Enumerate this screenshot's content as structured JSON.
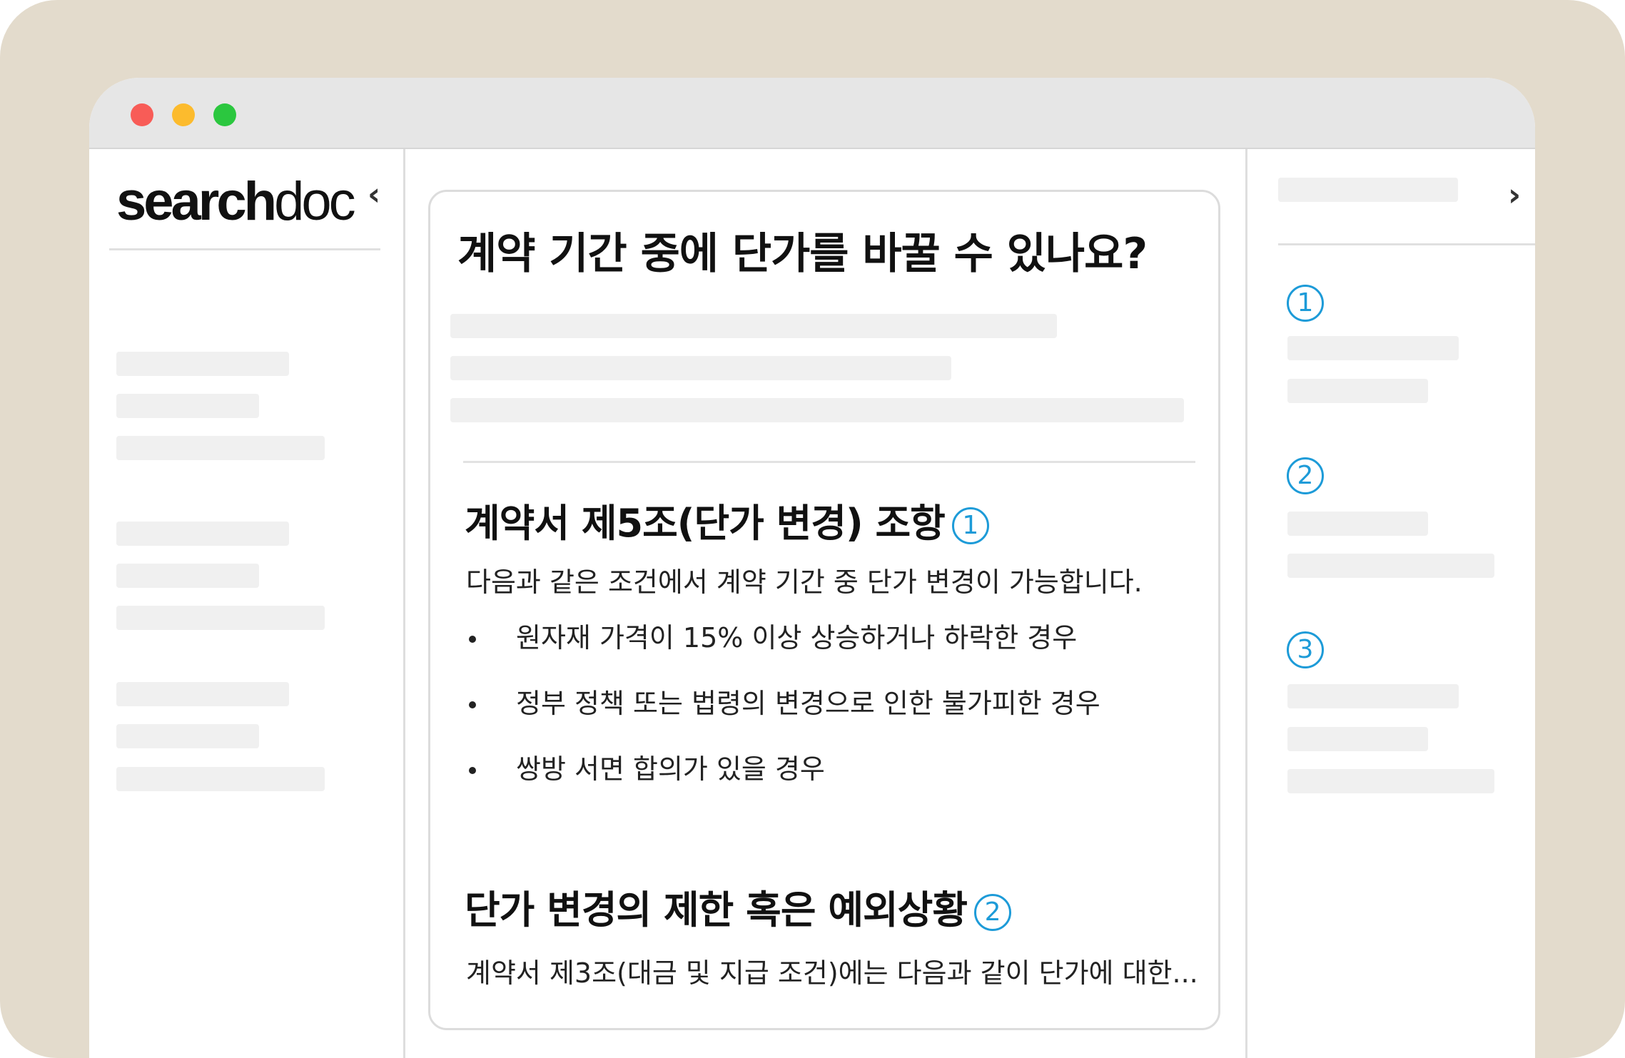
{
  "window": {
    "controls": [
      "close",
      "minimize",
      "maximize"
    ]
  },
  "sidebar": {
    "logo_bold": "search",
    "logo_light": "doc",
    "collapse_icon": "‹"
  },
  "main": {
    "question": "계약 기간 중에 단가를 바꿀 수 있나요?",
    "sections": [
      {
        "title": "계약서 제5조(단가 변경) 조항",
        "citation": "1",
        "intro": "다음과 같은 조건에서 계약 기간 중 단가 변경이 가능합니다.",
        "bullets": [
          "원자재 가격이 15% 이상 상승하거나 하락한 경우",
          "정부 정책 또는 법령의 변경으로 인한 불가피한 경우",
          "쌍방 서면 합의가 있을 경우"
        ]
      },
      {
        "title": "단가 변경의 제한 혹은 예외상황",
        "citation": "2",
        "intro": "계약서 제3조(대금 및 지급 조건)에는 다음과 같이 단가에 대한..."
      }
    ]
  },
  "references": {
    "expand_icon": "›",
    "items": [
      "1",
      "2",
      "3"
    ]
  },
  "colors": {
    "frame": "#e3dbcc",
    "accent": "#1d9bd8",
    "skeleton": "#f0f0f0"
  }
}
